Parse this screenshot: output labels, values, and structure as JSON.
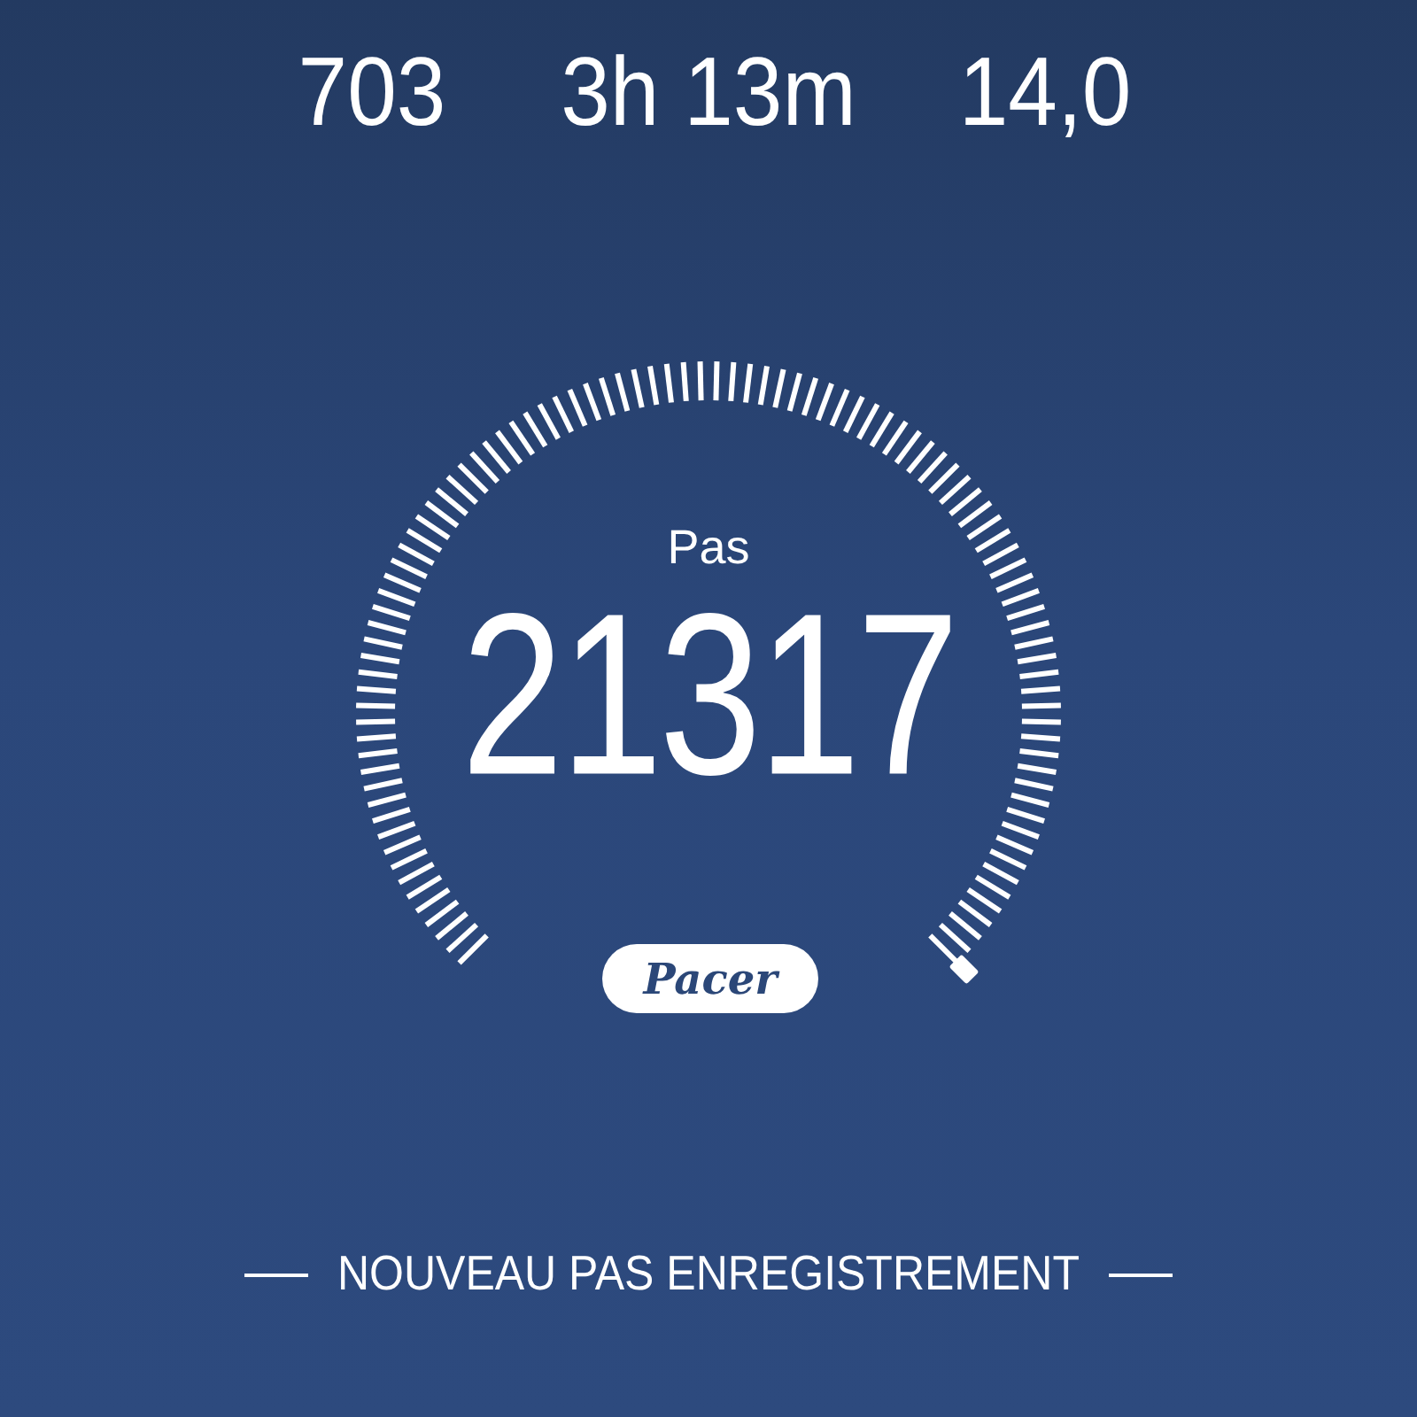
{
  "stats": [
    {
      "value": "703"
    },
    {
      "value": "3h 13m"
    },
    {
      "value": "14,0"
    }
  ],
  "gauge": {
    "label": "Pas",
    "value": "21317"
  },
  "brand": "Pacer",
  "banner": "NOUVEAU PAS ENREGISTREMENT"
}
